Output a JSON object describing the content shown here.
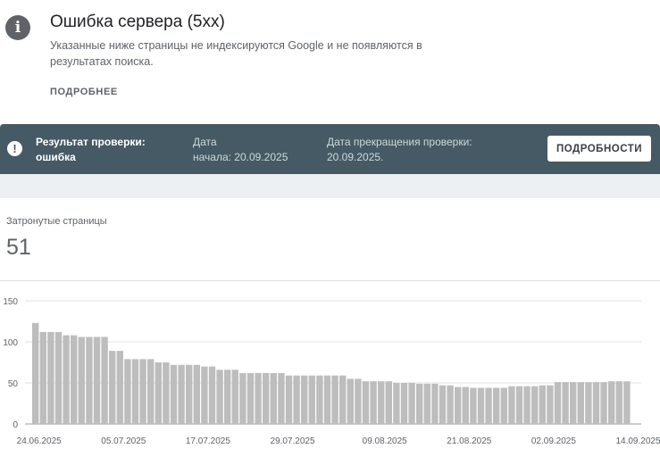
{
  "issue": {
    "icon": "info-icon",
    "title": "Ошибка сервера (5xx)",
    "description": "Указанные ниже страницы не индексируются Google и не появляются в результатах поиска.",
    "more_link": "ПОДРОБНЕЕ"
  },
  "validation": {
    "status_label": "Результат проверки:",
    "status_value": "ошибка",
    "start_label": "Дата",
    "start_value": "начала: 20.09.2025",
    "end_label": "Дата прекращения проверки:",
    "end_value": "20.09.2025.",
    "details_button": "ПОДРОБНОСТИ",
    "colors": {
      "banner": "#455a64"
    }
  },
  "metric": {
    "label": "Затронутые страницы",
    "value": "51"
  },
  "chart_data": {
    "type": "bar",
    "start_date": "24.06.2025",
    "x_tick_labels": [
      "24.06.2025",
      "05.07.2025",
      "17.07.2025",
      "29.07.2025",
      "09.08.2025",
      "21.08.2025",
      "02.09.2025",
      "14.09.2025"
    ],
    "y_ticks": [
      0,
      50,
      100,
      150
    ],
    "ylim": [
      0,
      150
    ],
    "bar_color": "#bdbdbd",
    "grid": true,
    "values": [
      123,
      112,
      112,
      112,
      108,
      108,
      106,
      106,
      106,
      106,
      89,
      89,
      79,
      79,
      79,
      79,
      75,
      75,
      72,
      72,
      72,
      72,
      70,
      70,
      66,
      66,
      66,
      62,
      62,
      62,
      62,
      62,
      62,
      59,
      59,
      59,
      59,
      59,
      59,
      59,
      59,
      55,
      55,
      52,
      52,
      52,
      52,
      50,
      50,
      50,
      49,
      49,
      49,
      47,
      47,
      45,
      45,
      44,
      44,
      44,
      44,
      44,
      46,
      46,
      46,
      46,
      47,
      47,
      51,
      51,
      51,
      51,
      51,
      51,
      51,
      52,
      52,
      52
    ]
  }
}
